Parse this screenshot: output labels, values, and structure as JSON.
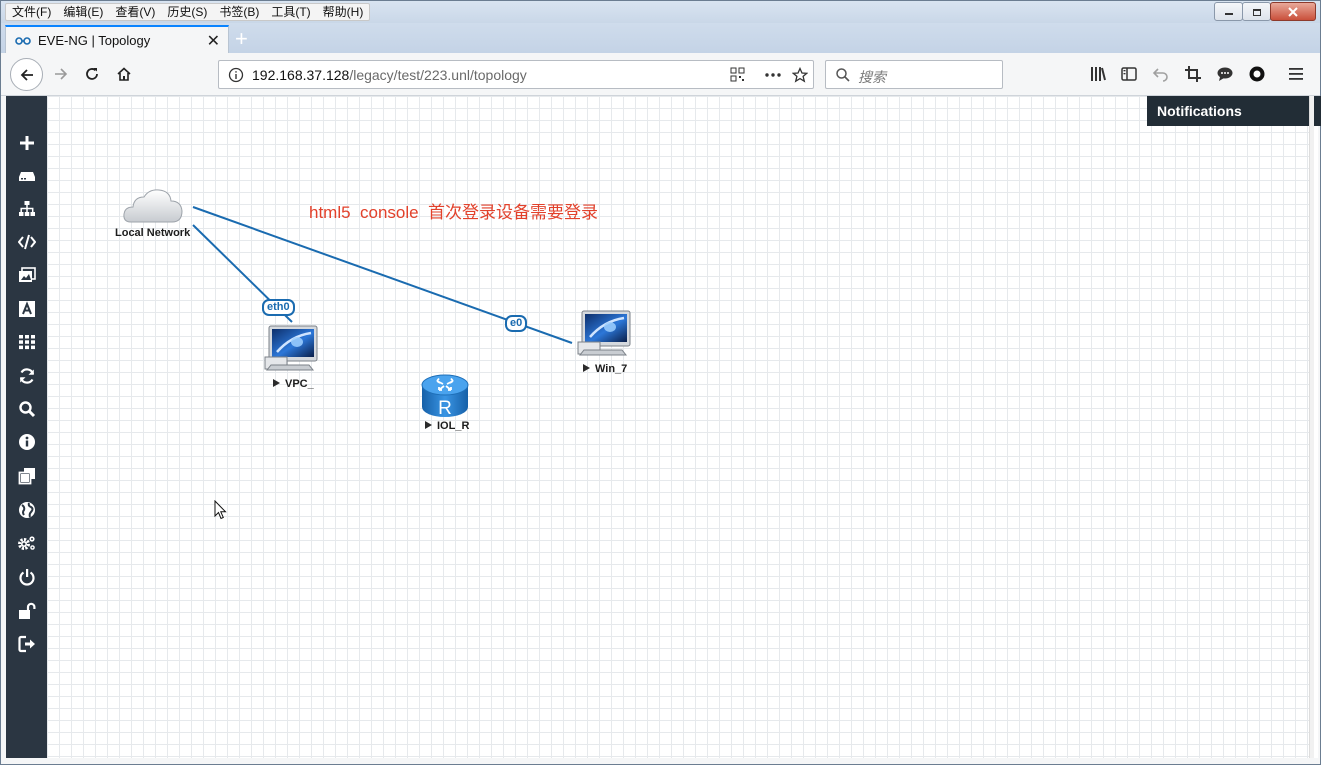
{
  "menubar": {
    "items": [
      "文件(F)",
      "编辑(E)",
      "查看(V)",
      "历史(S)",
      "书签(B)",
      "工具(T)",
      "帮助(H)"
    ]
  },
  "tab": {
    "title": "EVE-NG | Topology",
    "close": "✕",
    "new_tab": "+"
  },
  "navbar": {
    "url_host": "192.168.37.128",
    "url_path": "/legacy/test/223.unl/topology",
    "search_placeholder": "搜索"
  },
  "sidebar": {
    "icons": [
      "plus-icon",
      "server-icon",
      "sitemap-icon",
      "code-icon",
      "images-icon",
      "text-icon",
      "grid-icon",
      "refresh-icon",
      "search-icon",
      "info-icon",
      "copy-icon",
      "globe-icon",
      "cogs-icon",
      "power-icon",
      "unlock-icon",
      "logout-icon"
    ]
  },
  "notifications": {
    "title": "Notifications",
    "close": "✖"
  },
  "topology": {
    "annotation": "html5  console  首次登录设备需要登录",
    "nodes": {
      "cloud": "Local Network",
      "vpc": "VPC_",
      "win7": "Win_7",
      "router": "IOL_R",
      "router_letter": "R"
    },
    "interfaces": {
      "vpc_if": "eth0",
      "win7_if": "e0"
    }
  },
  "colors": {
    "sidebar_bg": "#2b3642",
    "link": "#1a6bb0",
    "annotation": "#e2412b",
    "router": "#1e78c8"
  }
}
